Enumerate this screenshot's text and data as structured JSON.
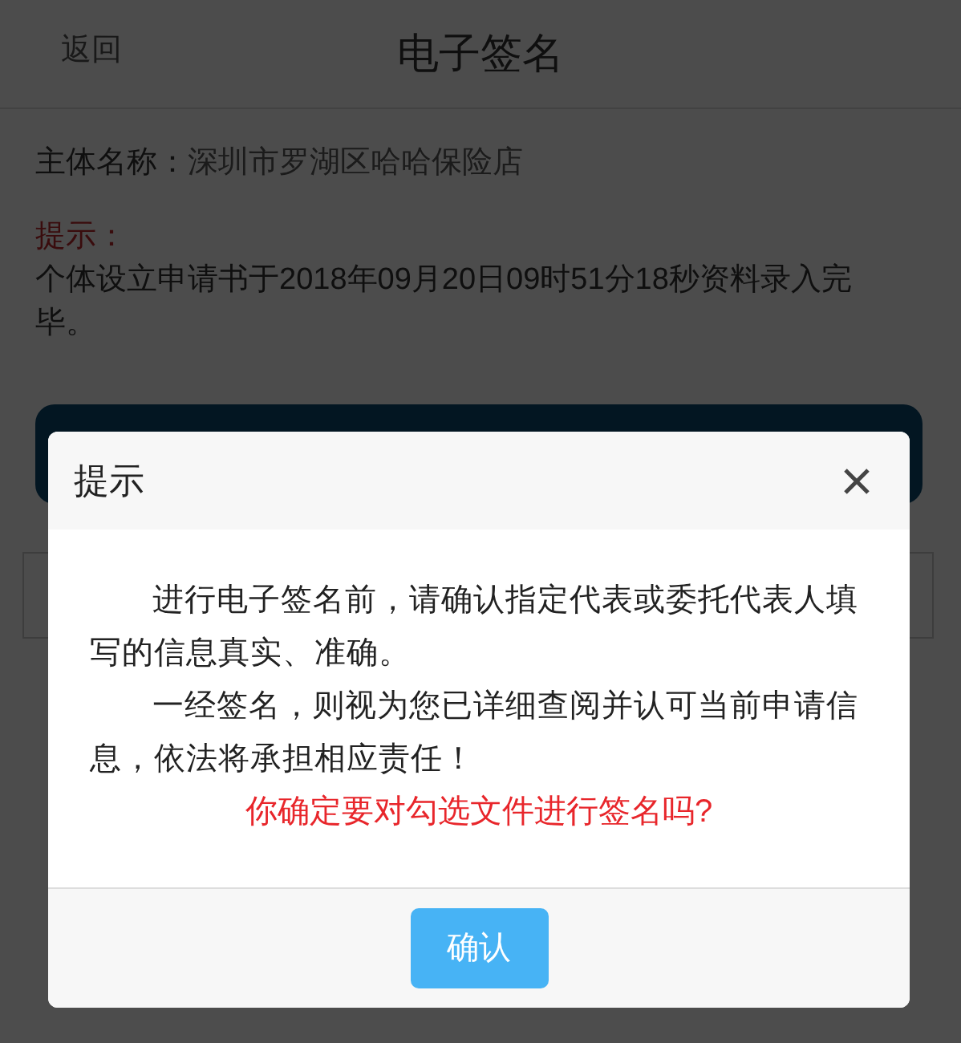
{
  "header": {
    "back": "返回",
    "title": "电子签名"
  },
  "subject": {
    "label": "主体名称：",
    "value": "深圳市罗湖区哈哈保险店"
  },
  "notice": {
    "label": "提示：",
    "text": "个体设立申请书于2018年09月20日09时51分18秒资料录入完毕。"
  },
  "dialog": {
    "title": "提示",
    "paragraphs": [
      "进行电子签名前，请确认指定代表或委托代表人填写的信息真实、准确。",
      "一经签名，则视为您已详细查阅并认可当前申请信息，依法将承担相应责任！"
    ],
    "question": "你确定要对勾选文件进行签名吗?",
    "confirm": "确认"
  }
}
